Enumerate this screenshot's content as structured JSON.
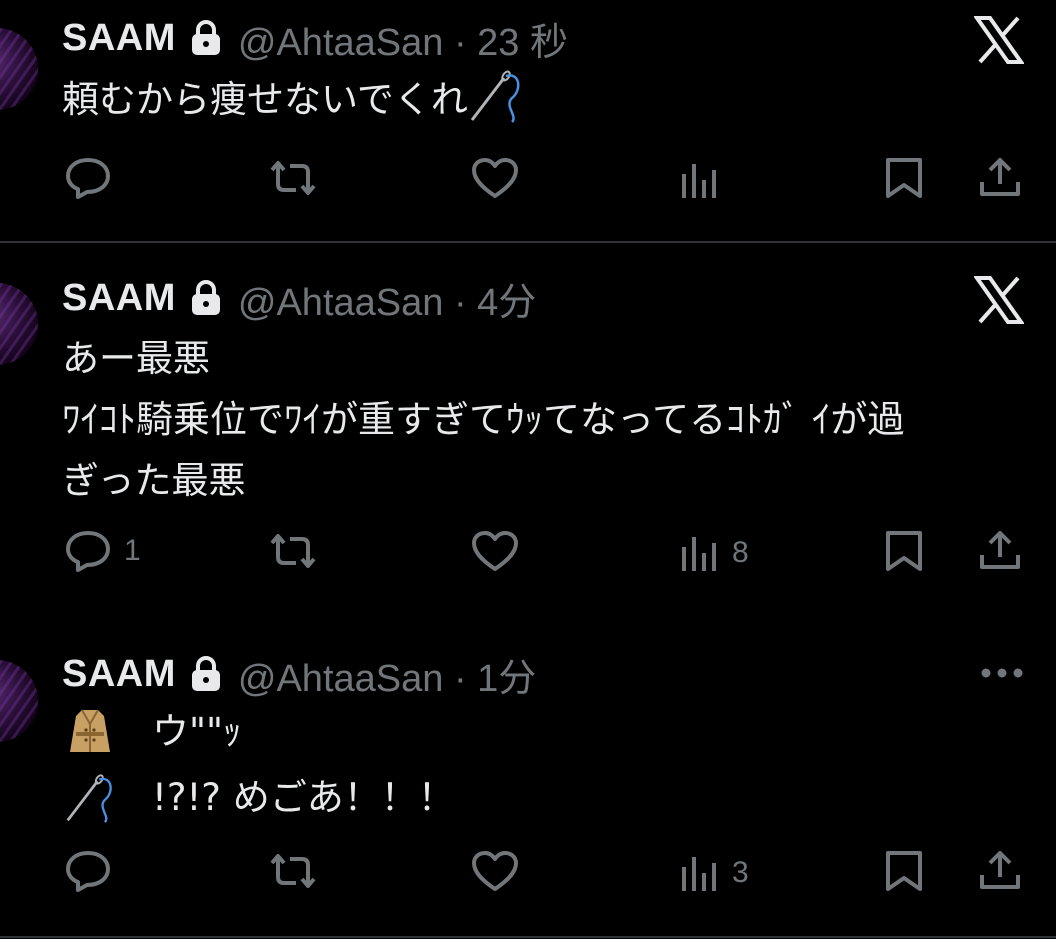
{
  "colors": {
    "background": "#000000",
    "text": "#e7e9ea",
    "muted": "#71767b",
    "divider": "#2f3336",
    "needle_thread": "#4a90e2"
  },
  "tweets": [
    {
      "name": "SAAM",
      "handle_time": "@AhtaaSan · 23 秒",
      "corner_icon": "x-logo-icon",
      "lines": [
        "頼むから痩せないでくれ"
      ],
      "trailing_emoji": "needle-thread-icon",
      "counts": {
        "reply": "",
        "views": ""
      }
    },
    {
      "name": "SAAM",
      "handle_time": "@AhtaaSan · 4分",
      "corner_icon": "x-logo-icon",
      "lines": [
        "あー最悪",
        "ﾜｲｺﾄ騎乗位でﾜｲが重すぎてｳｯてなってるｺﾄｶﾞ ｲが過",
        "ぎった最悪"
      ],
      "counts": {
        "reply": "1",
        "views": "8"
      }
    },
    {
      "name": "SAAM",
      "handle_time": "@AhtaaSan · 1分",
      "corner_icon": "more-icon",
      "lines": [
        "ウ\"\"ｯ",
        "!?!? めごあ！！！"
      ],
      "line_emojis": [
        "coat-icon",
        "needle-thread-icon"
      ],
      "counts": {
        "reply": "",
        "views": "3"
      }
    }
  ]
}
